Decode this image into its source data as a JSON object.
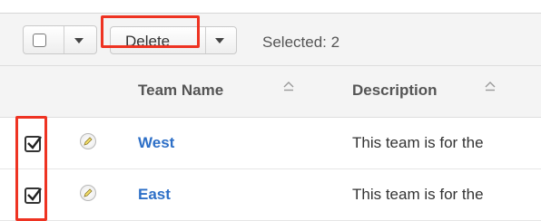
{
  "toolbar": {
    "delete_label": "Delete",
    "selected_text": "Selected: 2"
  },
  "table": {
    "columns": [
      {
        "label": "Team Name"
      },
      {
        "label": "Description"
      }
    ],
    "rows": [
      {
        "name": "West",
        "description": "This team is for the",
        "checked": true
      },
      {
        "name": "East",
        "description": "This team is for the",
        "checked": true
      }
    ]
  },
  "colors": {
    "highlight": "#ee3322",
    "link": "#2d6fc7",
    "header_bg": "#f4f4f4"
  }
}
